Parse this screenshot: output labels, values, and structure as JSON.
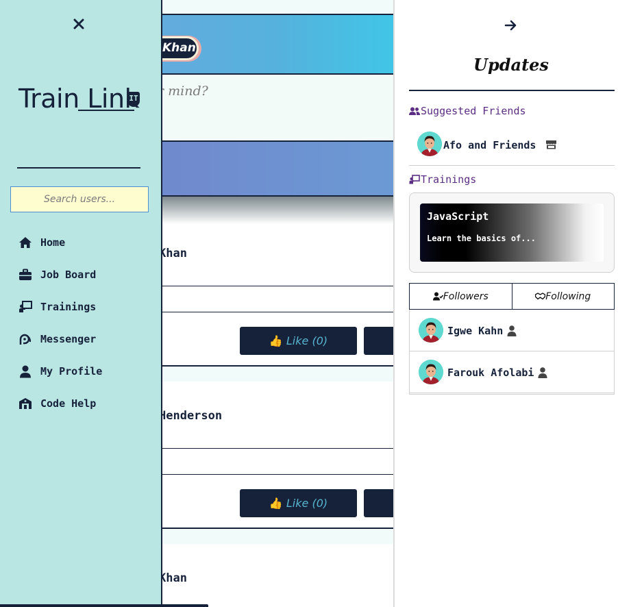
{
  "sidebar": {
    "logo_text": "Train Link",
    "logo_badge": "IT",
    "search_placeholder": "Search users...",
    "nav": [
      {
        "label": "Home",
        "icon": "home-icon"
      },
      {
        "label": "Job Board",
        "icon": "briefcase-icon"
      },
      {
        "label": "Trainings",
        "icon": "chalkboard-teacher-icon"
      },
      {
        "label": "Messenger",
        "icon": "messenger-icon"
      },
      {
        "label": "My Profile",
        "icon": "user-icon"
      },
      {
        "label": "Code Help",
        "icon": "code-help-icon"
      }
    ]
  },
  "feed": {
    "composer_name": "Khan",
    "composer_placeholder": "r mind?",
    "posts": [
      {
        "author": "Khan",
        "like_label": "Like (0)"
      },
      {
        "author": "Henderson",
        "like_label": "Like (0)"
      },
      {
        "author": "Khan"
      }
    ]
  },
  "updates": {
    "title": "Updates",
    "suggested_heading": "Suggested Friends",
    "suggested": [
      {
        "name": "Afo and Friends"
      }
    ],
    "trainings_heading": "Trainings",
    "trainings": [
      {
        "title": "JavaScript",
        "description": "Learn the basics of..."
      }
    ],
    "tabs": [
      {
        "label": "Followers"
      },
      {
        "label": "Following"
      }
    ],
    "followers": [
      {
        "name": "Igwe Kahn"
      },
      {
        "name": "Farouk Afolabi"
      }
    ]
  },
  "colors": {
    "sidebar_bg": "#b9e5e3",
    "navy": "#16213a",
    "accent_purple": "#5b2d84",
    "search_bg": "#fefdd0",
    "like_text": "#57b5cf"
  }
}
